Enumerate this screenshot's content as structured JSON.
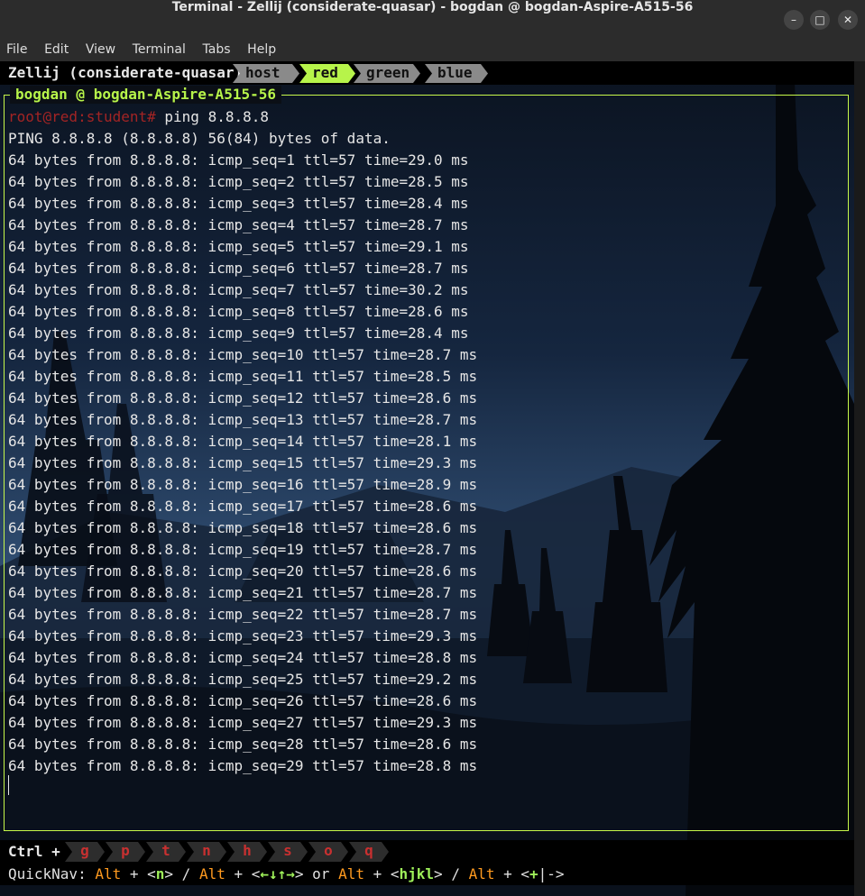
{
  "window": {
    "title": "Terminal - Zellij (considerate-quasar) - bogdan @ bogdan-Aspire-A515-56",
    "minimize": "–",
    "maximize": "□",
    "close": "✕"
  },
  "menu": [
    "File",
    "Edit",
    "View",
    "Terminal",
    "Tabs",
    "Help"
  ],
  "zellij": {
    "session": "Zellij (considerate-quasar)",
    "tabs": [
      "host",
      "red",
      "green",
      "blue"
    ],
    "active_tab": "red"
  },
  "pane": {
    "title": "bogdan @ bogdan-Aspire-A515-56"
  },
  "terminal": {
    "prompt": "root@red:student#",
    "command": " ping 8.8.8.8",
    "header": "PING 8.8.8.8 (8.8.8.8) 56(84) bytes of data.",
    "lines": [
      "64 bytes from 8.8.8.8: icmp_seq=1 ttl=57 time=29.0 ms",
      "64 bytes from 8.8.8.8: icmp_seq=2 ttl=57 time=28.5 ms",
      "64 bytes from 8.8.8.8: icmp_seq=3 ttl=57 time=28.4 ms",
      "64 bytes from 8.8.8.8: icmp_seq=4 ttl=57 time=28.7 ms",
      "64 bytes from 8.8.8.8: icmp_seq=5 ttl=57 time=29.1 ms",
      "64 bytes from 8.8.8.8: icmp_seq=6 ttl=57 time=28.7 ms",
      "64 bytes from 8.8.8.8: icmp_seq=7 ttl=57 time=30.2 ms",
      "64 bytes from 8.8.8.8: icmp_seq=8 ttl=57 time=28.6 ms",
      "64 bytes from 8.8.8.8: icmp_seq=9 ttl=57 time=28.4 ms",
      "64 bytes from 8.8.8.8: icmp_seq=10 ttl=57 time=28.7 ms",
      "64 bytes from 8.8.8.8: icmp_seq=11 ttl=57 time=28.5 ms",
      "64 bytes from 8.8.8.8: icmp_seq=12 ttl=57 time=28.6 ms",
      "64 bytes from 8.8.8.8: icmp_seq=13 ttl=57 time=28.7 ms",
      "64 bytes from 8.8.8.8: icmp_seq=14 ttl=57 time=28.1 ms",
      "64 bytes from 8.8.8.8: icmp_seq=15 ttl=57 time=29.3 ms",
      "64 bytes from 8.8.8.8: icmp_seq=16 ttl=57 time=28.9 ms",
      "64 bytes from 8.8.8.8: icmp_seq=17 ttl=57 time=28.6 ms",
      "64 bytes from 8.8.8.8: icmp_seq=18 ttl=57 time=28.6 ms",
      "64 bytes from 8.8.8.8: icmp_seq=19 ttl=57 time=28.7 ms",
      "64 bytes from 8.8.8.8: icmp_seq=20 ttl=57 time=28.6 ms",
      "64 bytes from 8.8.8.8: icmp_seq=21 ttl=57 time=28.7 ms",
      "64 bytes from 8.8.8.8: icmp_seq=22 ttl=57 time=28.7 ms",
      "64 bytes from 8.8.8.8: icmp_seq=23 ttl=57 time=29.3 ms",
      "64 bytes from 8.8.8.8: icmp_seq=24 ttl=57 time=28.8 ms",
      "64 bytes from 8.8.8.8: icmp_seq=25 ttl=57 time=29.2 ms",
      "64 bytes from 8.8.8.8: icmp_seq=26 ttl=57 time=28.6 ms",
      "64 bytes from 8.8.8.8: icmp_seq=27 ttl=57 time=29.3 ms",
      "64 bytes from 8.8.8.8: icmp_seq=28 ttl=57 time=28.6 ms",
      "64 bytes from 8.8.8.8: icmp_seq=29 ttl=57 time=28.8 ms"
    ]
  },
  "status": {
    "ctrl_label": "Ctrl +",
    "keys": [
      "g",
      "p",
      "t",
      "n",
      "h",
      "s",
      "o",
      "q"
    ],
    "quicknav": {
      "label": "QuickNav: ",
      "alt": "Alt",
      "plus": " + <",
      "n_key": "n",
      "close1": "> / ",
      "arrows": "←↓↑→",
      "or": "> or ",
      "hjkl": "hjkl",
      "close2": "> / ",
      "plusminus_a": "+",
      "plusminus_b": "|->"
    }
  },
  "colors": {
    "accent_green": "#b7f44a",
    "active_tab_bg": "#b7f44a",
    "inactive_tab_bg": "#8a8a8a",
    "prompt_red": "#a32424",
    "alt_orange": "#ff9a1f"
  }
}
